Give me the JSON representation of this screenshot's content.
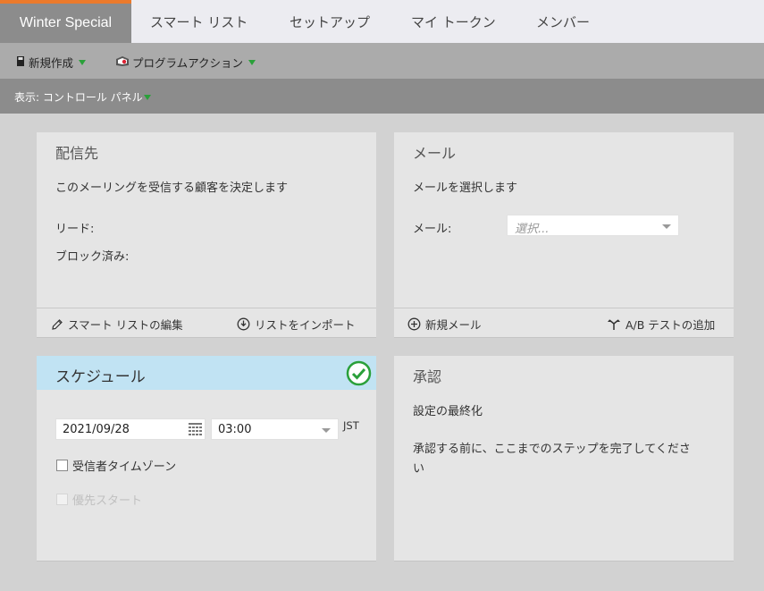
{
  "tabs": [
    {
      "label": "Winter Special",
      "active": true
    },
    {
      "label": "スマート リスト"
    },
    {
      "label": "セットアップ"
    },
    {
      "label": "マイ トークン"
    },
    {
      "label": "メンバー"
    }
  ],
  "toolbar": {
    "new_label": "新規作成",
    "program_actions_label": "プログラムアクション"
  },
  "view": {
    "label": "表示: コントロール パネル"
  },
  "audience": {
    "title": "配信先",
    "description": "このメーリングを受信する顧客を決定します",
    "leads_label": "リード:",
    "blocked_label": "ブロック済み:",
    "edit_smart_list": "スマート リストの編集",
    "import_list": "リストをインポート"
  },
  "email": {
    "title": "メール",
    "description": "メールを選択します",
    "field_label": "メール:",
    "select_placeholder": "選択...",
    "new_email": "新規メール",
    "add_ab_test": "A/B テストの追加"
  },
  "schedule": {
    "title": "スケジュール",
    "date": "2021/09/28",
    "time": "03:00",
    "timezone": "JST",
    "recipient_timezone": "受信者タイムゾーン",
    "priority_start": "優先スタート",
    "complete": true
  },
  "approval": {
    "title": "承認",
    "subtitle": "設定の最終化",
    "message": "承認する前に、ここまでのステップを完了してくださ",
    "message_cont": "い"
  },
  "colors": {
    "accent": "#ec7a2b",
    "success": "#2aa03a",
    "schedule_header": "#c1e3f3"
  }
}
